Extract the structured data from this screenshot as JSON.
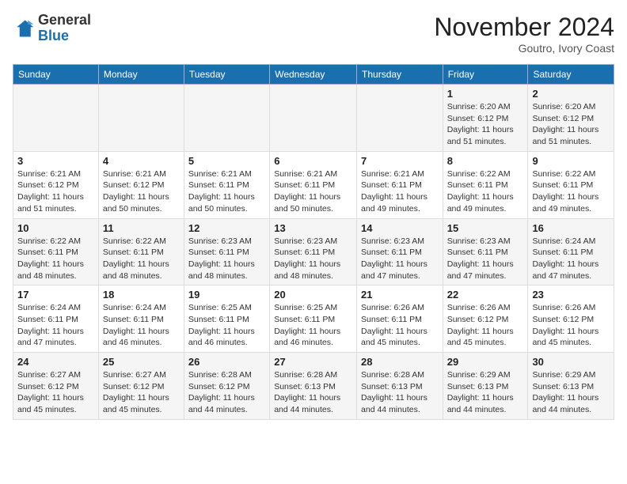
{
  "logo": {
    "general": "General",
    "blue": "Blue"
  },
  "header": {
    "month": "November 2024",
    "location": "Goutro, Ivory Coast"
  },
  "weekdays": [
    "Sunday",
    "Monday",
    "Tuesday",
    "Wednesday",
    "Thursday",
    "Friday",
    "Saturday"
  ],
  "weeks": [
    [
      {
        "day": "",
        "info": ""
      },
      {
        "day": "",
        "info": ""
      },
      {
        "day": "",
        "info": ""
      },
      {
        "day": "",
        "info": ""
      },
      {
        "day": "",
        "info": ""
      },
      {
        "day": "1",
        "info": "Sunrise: 6:20 AM\nSunset: 6:12 PM\nDaylight: 11 hours and 51 minutes."
      },
      {
        "day": "2",
        "info": "Sunrise: 6:20 AM\nSunset: 6:12 PM\nDaylight: 11 hours and 51 minutes."
      }
    ],
    [
      {
        "day": "3",
        "info": "Sunrise: 6:21 AM\nSunset: 6:12 PM\nDaylight: 11 hours and 51 minutes."
      },
      {
        "day": "4",
        "info": "Sunrise: 6:21 AM\nSunset: 6:12 PM\nDaylight: 11 hours and 50 minutes."
      },
      {
        "day": "5",
        "info": "Sunrise: 6:21 AM\nSunset: 6:11 PM\nDaylight: 11 hours and 50 minutes."
      },
      {
        "day": "6",
        "info": "Sunrise: 6:21 AM\nSunset: 6:11 PM\nDaylight: 11 hours and 50 minutes."
      },
      {
        "day": "7",
        "info": "Sunrise: 6:21 AM\nSunset: 6:11 PM\nDaylight: 11 hours and 49 minutes."
      },
      {
        "day": "8",
        "info": "Sunrise: 6:22 AM\nSunset: 6:11 PM\nDaylight: 11 hours and 49 minutes."
      },
      {
        "day": "9",
        "info": "Sunrise: 6:22 AM\nSunset: 6:11 PM\nDaylight: 11 hours and 49 minutes."
      }
    ],
    [
      {
        "day": "10",
        "info": "Sunrise: 6:22 AM\nSunset: 6:11 PM\nDaylight: 11 hours and 48 minutes."
      },
      {
        "day": "11",
        "info": "Sunrise: 6:22 AM\nSunset: 6:11 PM\nDaylight: 11 hours and 48 minutes."
      },
      {
        "day": "12",
        "info": "Sunrise: 6:23 AM\nSunset: 6:11 PM\nDaylight: 11 hours and 48 minutes."
      },
      {
        "day": "13",
        "info": "Sunrise: 6:23 AM\nSunset: 6:11 PM\nDaylight: 11 hours and 48 minutes."
      },
      {
        "day": "14",
        "info": "Sunrise: 6:23 AM\nSunset: 6:11 PM\nDaylight: 11 hours and 47 minutes."
      },
      {
        "day": "15",
        "info": "Sunrise: 6:23 AM\nSunset: 6:11 PM\nDaylight: 11 hours and 47 minutes."
      },
      {
        "day": "16",
        "info": "Sunrise: 6:24 AM\nSunset: 6:11 PM\nDaylight: 11 hours and 47 minutes."
      }
    ],
    [
      {
        "day": "17",
        "info": "Sunrise: 6:24 AM\nSunset: 6:11 PM\nDaylight: 11 hours and 47 minutes."
      },
      {
        "day": "18",
        "info": "Sunrise: 6:24 AM\nSunset: 6:11 PM\nDaylight: 11 hours and 46 minutes."
      },
      {
        "day": "19",
        "info": "Sunrise: 6:25 AM\nSunset: 6:11 PM\nDaylight: 11 hours and 46 minutes."
      },
      {
        "day": "20",
        "info": "Sunrise: 6:25 AM\nSunset: 6:11 PM\nDaylight: 11 hours and 46 minutes."
      },
      {
        "day": "21",
        "info": "Sunrise: 6:26 AM\nSunset: 6:11 PM\nDaylight: 11 hours and 45 minutes."
      },
      {
        "day": "22",
        "info": "Sunrise: 6:26 AM\nSunset: 6:12 PM\nDaylight: 11 hours and 45 minutes."
      },
      {
        "day": "23",
        "info": "Sunrise: 6:26 AM\nSunset: 6:12 PM\nDaylight: 11 hours and 45 minutes."
      }
    ],
    [
      {
        "day": "24",
        "info": "Sunrise: 6:27 AM\nSunset: 6:12 PM\nDaylight: 11 hours and 45 minutes."
      },
      {
        "day": "25",
        "info": "Sunrise: 6:27 AM\nSunset: 6:12 PM\nDaylight: 11 hours and 45 minutes."
      },
      {
        "day": "26",
        "info": "Sunrise: 6:28 AM\nSunset: 6:12 PM\nDaylight: 11 hours and 44 minutes."
      },
      {
        "day": "27",
        "info": "Sunrise: 6:28 AM\nSunset: 6:13 PM\nDaylight: 11 hours and 44 minutes."
      },
      {
        "day": "28",
        "info": "Sunrise: 6:28 AM\nSunset: 6:13 PM\nDaylight: 11 hours and 44 minutes."
      },
      {
        "day": "29",
        "info": "Sunrise: 6:29 AM\nSunset: 6:13 PM\nDaylight: 11 hours and 44 minutes."
      },
      {
        "day": "30",
        "info": "Sunrise: 6:29 AM\nSunset: 6:13 PM\nDaylight: 11 hours and 44 minutes."
      }
    ]
  ]
}
